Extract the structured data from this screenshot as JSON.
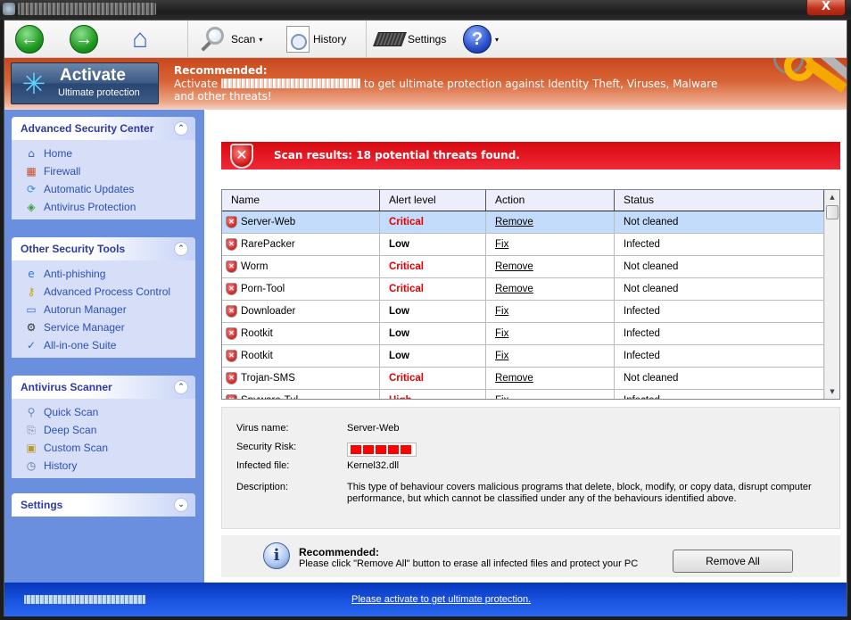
{
  "window": {
    "title_redacted": true,
    "close_label": "X"
  },
  "toolbar": {
    "back_icon": "←",
    "forward_icon": "→",
    "home_icon": "⌂",
    "scan_label": "Scan",
    "history_label": "History",
    "settings_label": "Settings",
    "help_icon": "?",
    "caret": "▾"
  },
  "banner": {
    "activate_title": "Activate",
    "activate_subtitle": "Ultimate protection",
    "activate_icon": "✳",
    "rec_title": "Recommended:",
    "rec_text_before": "Activate ",
    "rec_text_after": " to get ultimate protection against Identity Theft, Viruses, Malware and other threats!"
  },
  "sidebar": {
    "collapse_icon": "⌃",
    "expand_icon": "⌄",
    "panels": [
      {
        "title": "Advanced Security Center",
        "items": [
          {
            "label": "Home",
            "icon": "home-icon",
            "glyph": "⌂",
            "color": "#3d64b8"
          },
          {
            "label": "Firewall",
            "icon": "firewall-icon",
            "glyph": "▦",
            "color": "#c8522c"
          },
          {
            "label": "Automatic Updates",
            "icon": "updates-icon",
            "glyph": "⟳",
            "color": "#3a8ad8"
          },
          {
            "label": "Antivirus Protection",
            "icon": "shield-icon",
            "glyph": "◈",
            "color": "#3aa043"
          }
        ]
      },
      {
        "title": "Other Security Tools",
        "items": [
          {
            "label": "Anti-phishing",
            "icon": "ie-icon",
            "glyph": "e",
            "color": "#2a7bd6"
          },
          {
            "label": "Advanced Process Control",
            "icon": "keys-icon",
            "glyph": "⚷",
            "color": "#c7a400"
          },
          {
            "label": "Autorun Manager",
            "icon": "autorun-icon",
            "glyph": "▭",
            "color": "#3b6fd0"
          },
          {
            "label": "Service Manager",
            "icon": "service-icon",
            "glyph": "⚙",
            "color": "#333"
          },
          {
            "label": "All-in-one Suite",
            "icon": "checklist-icon",
            "glyph": "✓",
            "color": "#2a6fc9"
          }
        ]
      },
      {
        "title": "Antivirus Scanner",
        "items": [
          {
            "label": "Quick Scan",
            "icon": "magnifier-icon",
            "glyph": "⚲",
            "color": "#6a87b5"
          },
          {
            "label": "Deep Scan",
            "icon": "document-search-icon",
            "glyph": "⎘",
            "color": "#7a8aa5"
          },
          {
            "label": "Custom Scan",
            "icon": "folder-search-icon",
            "glyph": "▣",
            "color": "#b89a35"
          },
          {
            "label": "History",
            "icon": "clock-icon",
            "glyph": "◷",
            "color": "#5a6f95"
          }
        ]
      },
      {
        "title": "Settings",
        "items": []
      }
    ]
  },
  "main": {
    "alert_text": "Scan results: 18 potential threats found.",
    "alert_icon": "✕",
    "columns": [
      "Name",
      "Alert level",
      "Action",
      "Status"
    ],
    "rows": [
      {
        "name": "Server-Web",
        "level": "Critical",
        "action": "Remove",
        "status": "Not cleaned",
        "selected": true
      },
      {
        "name": "RarePacker",
        "level": "Low",
        "action": "Fix",
        "status": "Infected"
      },
      {
        "name": "Worm",
        "level": "Critical",
        "action": "Remove",
        "status": "Not cleaned"
      },
      {
        "name": "Porn-Tool",
        "level": "Critical",
        "action": "Remove",
        "status": "Not cleaned"
      },
      {
        "name": "Downloader",
        "level": "Low",
        "action": "Fix",
        "status": "Infected"
      },
      {
        "name": "Rootkit",
        "level": "Low",
        "action": "Fix",
        "status": "Infected"
      },
      {
        "name": "Rootkit",
        "level": "Low",
        "action": "Fix",
        "status": "Infected"
      },
      {
        "name": "Trojan-SMS",
        "level": "Critical",
        "action": "Remove",
        "status": "Not cleaned"
      },
      {
        "name": "Spyware-Tul...",
        "level": "High",
        "action": "Fix",
        "status": "Infected"
      }
    ],
    "scroll_up": "▲",
    "scroll_down": "▼",
    "details": {
      "virus_name_label": "Virus name:",
      "virus_name": "Server-Web",
      "risk_label": "Security Risk:",
      "risk_level": 5,
      "risk_max": 5,
      "file_label": "Infected file:",
      "file": "Kernel32.dll",
      "desc_label": "Description:",
      "description": "This type of behaviour covers malicious programs that delete, block, modify, or copy data, disrupt computer performance, but which cannot be classified under any of the behaviours identified above."
    },
    "recommend": {
      "icon": "i",
      "title": "Recommended:",
      "text": "Please click \"Remove All\" button to erase all infected files and protect your PC",
      "button": "Remove All"
    }
  },
  "footer": {
    "link": "Please activate to get ultimate protection."
  }
}
